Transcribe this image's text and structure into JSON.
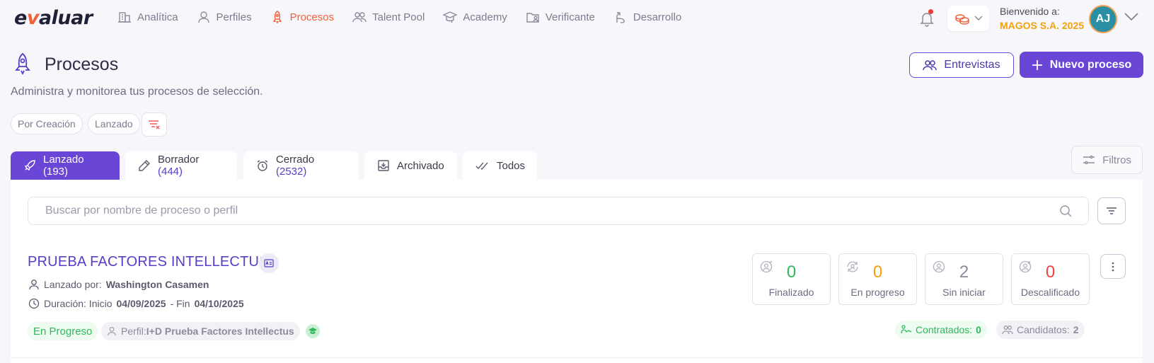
{
  "brand": {
    "logo_pre": "e",
    "logo_v": "v",
    "logo_post": "aluar"
  },
  "nav": [
    {
      "label": "Analítica",
      "icon": "building-icon"
    },
    {
      "label": "Perfiles",
      "icon": "user-icon"
    },
    {
      "label": "Procesos",
      "icon": "rocket-icon",
      "active": true
    },
    {
      "label": "Talent Pool",
      "icon": "users-icon"
    },
    {
      "label": "Academy",
      "icon": "graduation-cap-icon"
    },
    {
      "label": "Verificante",
      "icon": "folder-user-icon"
    },
    {
      "label": "Desarrollo",
      "icon": "growth-icon"
    }
  ],
  "header_user": {
    "welcome": "Bienvenido a:",
    "company": "MAGOS S.A. 2025",
    "initials": "AJ"
  },
  "page": {
    "title": "Procesos",
    "subtitle": "Administra y monitorea tus procesos de selección.",
    "interviews_label": "Entrevistas",
    "new_process_label": "Nuevo proceso"
  },
  "chips": [
    "Por Creación",
    "Lanzado"
  ],
  "tabs": [
    {
      "label": "Lanzado",
      "count": "(193)",
      "icon": "rocket-icon"
    },
    {
      "label": "Borrador",
      "count": "(444)",
      "icon": "pencil-icon"
    },
    {
      "label": "Cerrado",
      "count": "(2532)",
      "icon": "alarm-icon"
    },
    {
      "label": "Archivado",
      "count": "",
      "icon": "archive-icon"
    },
    {
      "label": "Todos",
      "count": "",
      "icon": "double-check-icon"
    }
  ],
  "filters_label": "Filtros",
  "search": {
    "placeholder": "Buscar por nombre de proceso o perfil"
  },
  "process": {
    "title": "PRUEBA FACTORES INTELLECTUS",
    "launched_prefix": "Lanzado por:",
    "launched_by": "Washington Casamen",
    "duration_prefix": "Duración: Inicio",
    "start": "04/09/2025",
    "end_prefix": "- Fin",
    "end": "04/10/2025",
    "status": "En Progreso",
    "perfil_prefix": "Perfil:",
    "perfil": "I+D Prueba Factores Intellectus",
    "stats": [
      {
        "value": "0",
        "label": "Finalizado",
        "color": "#2fb85c"
      },
      {
        "value": "0",
        "label": "En progreso",
        "color": "#f2a20c"
      },
      {
        "value": "2",
        "label": "Sin iniciar",
        "color": "#8a8c9c"
      },
      {
        "value": "0",
        "label": "Descalificado",
        "color": "#ef4444"
      }
    ],
    "hired_label": "Contratados:",
    "hired": "0",
    "candidates_label": "Candidatos:",
    "candidates": "2"
  }
}
